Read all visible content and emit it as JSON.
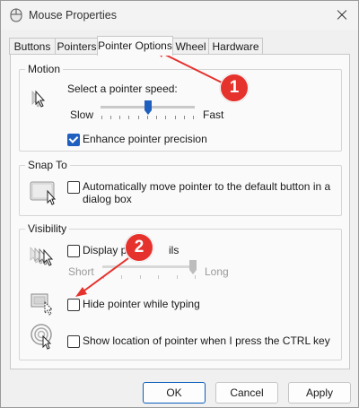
{
  "window": {
    "title": "Mouse Properties"
  },
  "tabs": [
    {
      "label": "Buttons"
    },
    {
      "label": "Pointers"
    },
    {
      "label": "Pointer Options",
      "active": true
    },
    {
      "label": "Wheel"
    },
    {
      "label": "Hardware"
    }
  ],
  "motion": {
    "title": "Motion",
    "speed_label": "Select a pointer speed:",
    "slow_label": "Slow",
    "fast_label": "Fast",
    "speed_level": 0.5,
    "enhance_label": "Enhance pointer precision",
    "enhance_checked": true
  },
  "snap_to": {
    "title": "Snap To",
    "label_line1": "Automatically move pointer to the default button in a",
    "label_line2": "dialog box",
    "checked": false
  },
  "visibility": {
    "title": "Visibility",
    "trails_label_start": "Display po",
    "trails_label_end": "ils",
    "trails_checked": false,
    "short_label": "Short",
    "long_label": "Long",
    "trail_level": 1.0,
    "hide_label": "Hide pointer while typing",
    "hide_checked": false,
    "show_location_label": "Show location of pointer when I press the CTRL key",
    "show_location_checked": false
  },
  "buttons": {
    "ok": "OK",
    "cancel": "Cancel",
    "apply": "Apply"
  },
  "annotations": {
    "badge1": "1",
    "badge2": "2",
    "color": "#e5322d"
  },
  "colors": {
    "accent": "#1f5fbf",
    "highlight": "#0b5dba"
  }
}
